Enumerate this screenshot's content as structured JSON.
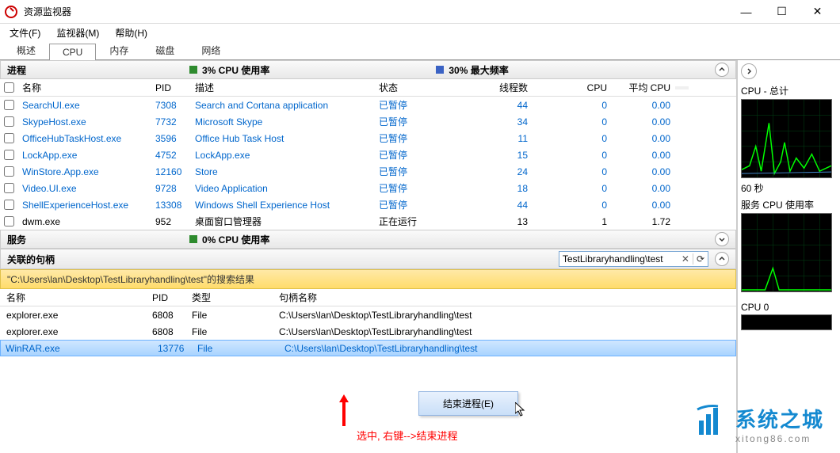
{
  "window": {
    "title": "资源监视器"
  },
  "menu": {
    "file": "文件(F)",
    "monitor": "监视器(M)",
    "help": "帮助(H)"
  },
  "tabs": {
    "overview": "概述",
    "cpu": "CPU",
    "memory": "内存",
    "disk": "磁盘",
    "network": "网络"
  },
  "sections": {
    "processes": {
      "title": "进程",
      "meter1_label": "3% CPU 使用率",
      "meter1_color": "#2e8b2e",
      "meter2_label": "30% 最大频率",
      "meter2_color": "#3a62c4"
    },
    "services": {
      "title": "服务",
      "meter1_label": "0% CPU 使用率",
      "meter1_color": "#2e8b2e"
    },
    "handles": {
      "title": "关联的句柄",
      "search_value": "TestLibraryhandling\\test",
      "search_result_label": "\"C:\\Users\\lan\\Desktop\\TestLibraryhandling\\test\"的搜索结果"
    }
  },
  "proc_headers": {
    "name": "名称",
    "pid": "PID",
    "desc": "描述",
    "status": "状态",
    "threads": "线程数",
    "cpu": "CPU",
    "avg": "平均 CPU"
  },
  "processes": [
    {
      "name": "SearchUI.exe",
      "pid": "7308",
      "desc": "Search and Cortana application",
      "status": "已暂停",
      "threads": "44",
      "cpu": "0",
      "avg": "0.00"
    },
    {
      "name": "SkypeHost.exe",
      "pid": "7732",
      "desc": "Microsoft Skype",
      "status": "已暂停",
      "threads": "34",
      "cpu": "0",
      "avg": "0.00"
    },
    {
      "name": "OfficeHubTaskHost.exe",
      "pid": "3596",
      "desc": "Office Hub Task Host",
      "status": "已暂停",
      "threads": "11",
      "cpu": "0",
      "avg": "0.00"
    },
    {
      "name": "LockApp.exe",
      "pid": "4752",
      "desc": "LockApp.exe",
      "status": "已暂停",
      "threads": "15",
      "cpu": "0",
      "avg": "0.00"
    },
    {
      "name": "WinStore.App.exe",
      "pid": "12160",
      "desc": "Store",
      "status": "已暂停",
      "threads": "24",
      "cpu": "0",
      "avg": "0.00"
    },
    {
      "name": "Video.UI.exe",
      "pid": "9728",
      "desc": "Video Application",
      "status": "已暂停",
      "threads": "18",
      "cpu": "0",
      "avg": "0.00"
    },
    {
      "name": "ShellExperienceHost.exe",
      "pid": "13308",
      "desc": "Windows Shell Experience Host",
      "status": "已暂停",
      "threads": "44",
      "cpu": "0",
      "avg": "0.00"
    },
    {
      "name": "dwm.exe",
      "pid": "952",
      "desc": "桌面窗口管理器",
      "status": "正在运行",
      "threads": "13",
      "cpu": "1",
      "avg": "1.72"
    }
  ],
  "handle_headers": {
    "name": "名称",
    "pid": "PID",
    "type": "类型",
    "handle": "句柄名称"
  },
  "handles": [
    {
      "name": "explorer.exe",
      "pid": "6808",
      "type": "File",
      "handle": "C:\\Users\\lan\\Desktop\\TestLibraryhandling\\test"
    },
    {
      "name": "explorer.exe",
      "pid": "6808",
      "type": "File",
      "handle": "C:\\Users\\lan\\Desktop\\TestLibraryhandling\\test"
    },
    {
      "name": "WinRAR.exe",
      "pid": "13776",
      "type": "File",
      "handle": "C:\\Users\\lan\\Desktop\\TestLibraryhandling\\test"
    }
  ],
  "context_menu": {
    "end_process": "结束进程(E)"
  },
  "annotation": {
    "text": "选中, 右键-->结束进程"
  },
  "right_panel": {
    "cpu_total": "CPU - 总计",
    "seconds": "60 秒",
    "service_cpu": "服务 CPU 使用率",
    "cpu0": "CPU 0"
  },
  "logo": {
    "text": "系统之城",
    "sub": "xitong86.com"
  }
}
